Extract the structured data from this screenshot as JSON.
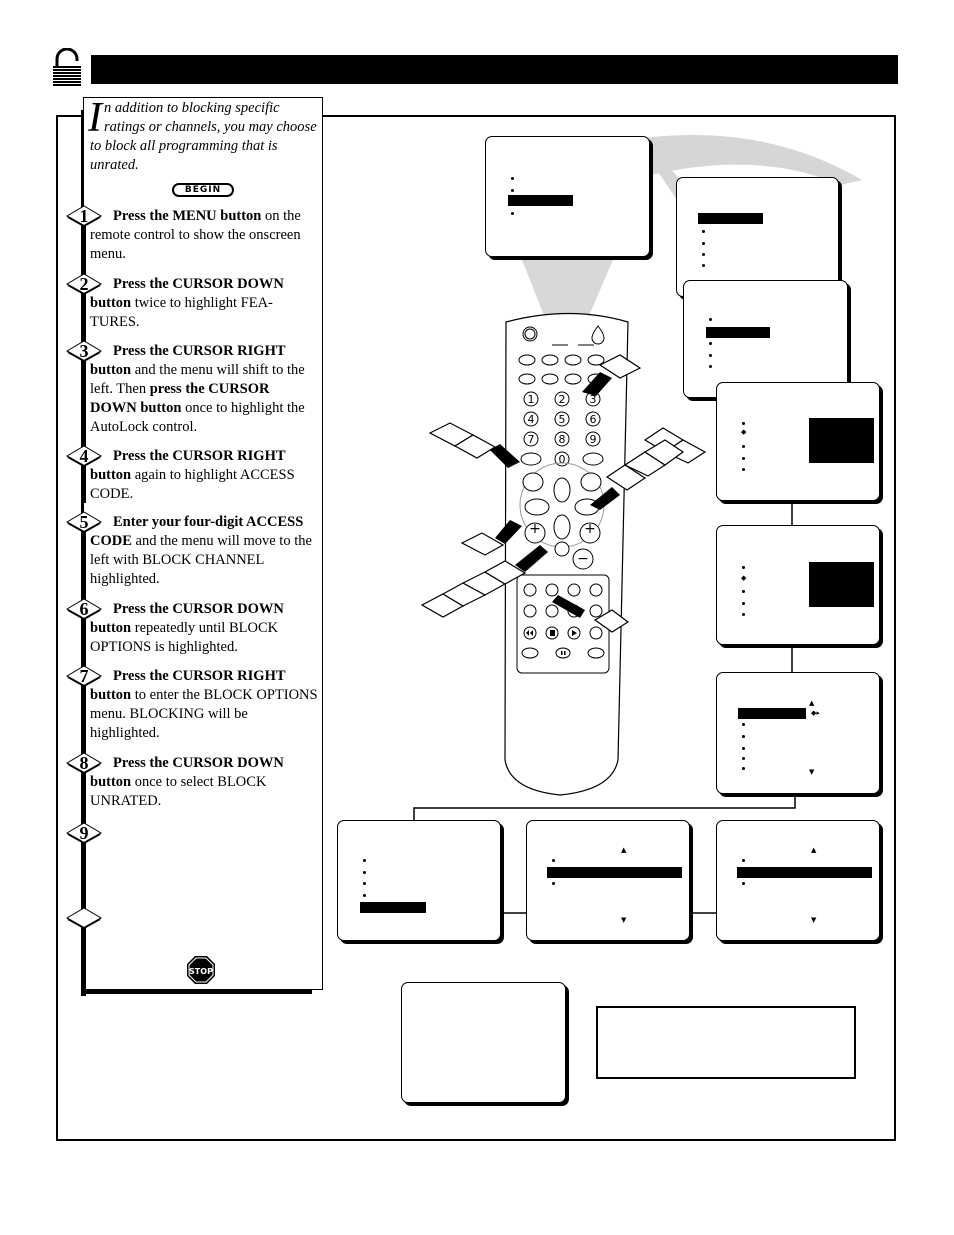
{
  "header": {
    "title": "",
    "lock_icon": "open-padlock-icon"
  },
  "intro": {
    "dropcap": "I",
    "text": "n addition to blocking specific ratings or channels, you may choose to block all programming that is unrated."
  },
  "begin_label": "BEGIN",
  "steps": [
    {
      "number": "1",
      "bold": "Press the MENU button",
      "text": " on the remote control to show the onscreen menu."
    },
    {
      "number": "2",
      "bold": "Press the CURSOR DOWN button",
      "text": " twice to highlight FEA-TURES."
    },
    {
      "number": "3",
      "bold": "Press the CURSOR RIGHT button",
      "text": " and the menu will shift to the left. Then ",
      "bold2": "press the CURSOR DOWN button",
      "text2": " once to highlight the AutoLock control."
    },
    {
      "number": "4",
      "bold": "Press the CURSOR RIGHT button",
      "text": " again to highlight ACCESS CODE."
    },
    {
      "number": "5",
      "bold": "Enter your four-digit ACCESS CODE",
      "text": " and the menu will move to the left with BLOCK CHANNEL highlighted."
    },
    {
      "number": "6",
      "bold": "Press the CURSOR DOWN button",
      "text": " repeatedly until BLOCK OPTIONS is highlighted."
    },
    {
      "number": "7",
      "bold": "Press the CURSOR RIGHT button",
      "text": " to enter the BLOCK OPTIONS menu. BLOCKING will be highlighted."
    },
    {
      "number": "8",
      "bold": "Press the CURSOR DOWN button",
      "text": " once to select BLOCK UNRATED."
    },
    {
      "number": "9",
      "bold": "",
      "text": ""
    },
    {
      "number": "",
      "bold": "",
      "text": ""
    }
  ],
  "stop_label": "STOP",
  "remote": {
    "keypad": [
      "1",
      "2",
      "3",
      "4",
      "5",
      "6",
      "7",
      "8",
      "9",
      "0"
    ],
    "plus_label": "+",
    "minus_label": "−"
  },
  "note_box": {
    "text": ""
  }
}
